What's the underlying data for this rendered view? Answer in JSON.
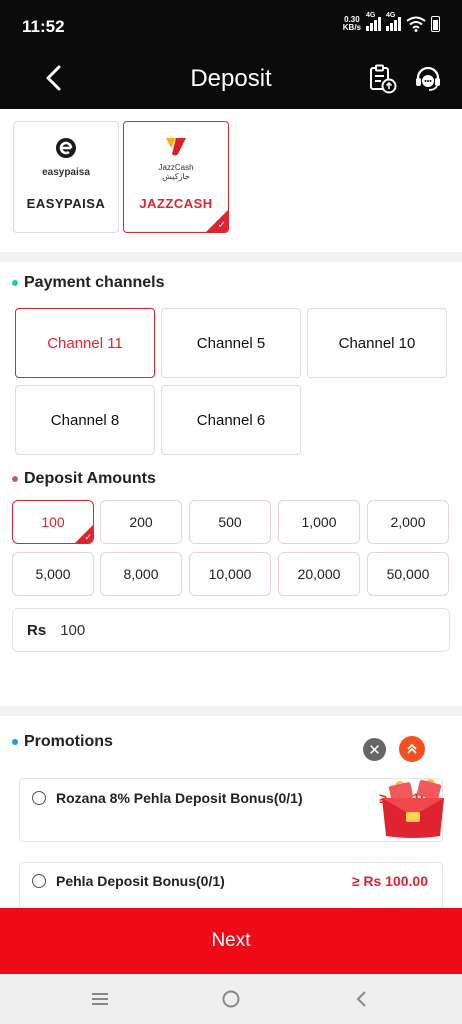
{
  "status_bar": {
    "time": "11:52",
    "speed_value": "0.30",
    "speed_unit": "KB/s",
    "net1": "4G",
    "net2": "4G"
  },
  "header": {
    "title": "Deposit"
  },
  "wallets": [
    {
      "name": "EASYPAISA",
      "logo_text": "easypaisa",
      "selected": false
    },
    {
      "name": "JAZZCASH",
      "logo_text": "JazzCash",
      "logo_sub": "جازکیش",
      "selected": true
    }
  ],
  "payment_channels": {
    "title": "Payment channels",
    "items": [
      "Channel 11",
      "Channel 5",
      "Channel 10",
      "Channel 8",
      "Channel 6"
    ],
    "selected": "Channel 11"
  },
  "deposit_amounts": {
    "title": "Deposit Amounts",
    "items": [
      "100",
      "200",
      "500",
      "1,000",
      "2,000",
      "5,000",
      "8,000",
      "10,000",
      "20,000",
      "50,000"
    ],
    "selected": "100"
  },
  "amount_input": {
    "currency": "Rs",
    "value": "100"
  },
  "promotions": {
    "title": "Promotions",
    "items": [
      {
        "name": "Rozana 8% Pehla Deposit Bonus(0/1)",
        "amount": "≥ Rs 10"
      },
      {
        "name": "Pehla Deposit Bonus(0/1)",
        "amount": "≥ Rs 100.00"
      }
    ]
  },
  "next_button": {
    "label": "Next"
  },
  "colors": {
    "accent": "#e0242f",
    "next_bg": "#f00a15",
    "header_bg": "#0b0b0b",
    "dot_channels": "#1ec8b4",
    "dot_amounts": "#c0606a",
    "dot_promotions": "#1e9ee0"
  }
}
